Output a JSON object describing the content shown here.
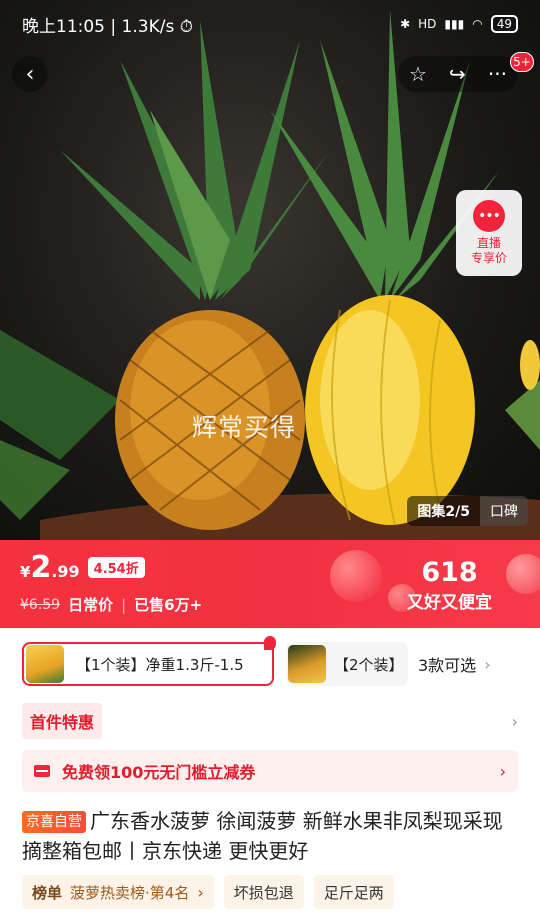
{
  "status_bar": {
    "time": "晚上11:05",
    "speed": "1.3K/s",
    "battery": "49",
    "signal_label": "HD"
  },
  "topbar": {
    "back_icon": "chevron-left-icon",
    "favorite_icon": "star-icon",
    "share_icon": "share-icon",
    "more_icon": "more-dots-icon",
    "more_glyph": "···",
    "notification_badge": "5+"
  },
  "hero": {
    "watermark": "辉常买得",
    "live_button": {
      "icon_glyph": "•••",
      "line1": "直播",
      "line2": "专享价"
    },
    "gallery": {
      "label": "图集2/5",
      "reviews": "口碑"
    }
  },
  "price": {
    "currency": "¥",
    "integer": "2",
    "decimal": ".99",
    "discount": "4.54折",
    "original": "¥6.59",
    "original_label": "日常价",
    "separator": "|",
    "sold": "已售6万+",
    "promo_number": "618",
    "promo_slogan": "又好又便宜"
  },
  "variants": {
    "selected_label": "【1个装】净重1.3斤-1.5",
    "other_label": "【2个装】",
    "more_text": "3款可选"
  },
  "first_deal": {
    "label": "首件特惠"
  },
  "coupon": {
    "text": "免费领100元无门槛立减券"
  },
  "product": {
    "store_tag": "京喜自营",
    "title": "广东香水菠萝 徐闻菠萝 新鲜水果非凤梨现采现摘整箱包邮丨京东快递 更快更好"
  },
  "tags": {
    "rank_label": "榜单",
    "rank_text": "菠萝热卖榜·第4名",
    "damage": "坏损包退",
    "weight": "足斤足两"
  },
  "colors": {
    "brand_red": "#f2233a",
    "coupon_bg": "#fdf0ee",
    "tag_bg": "#fdf3e8"
  }
}
